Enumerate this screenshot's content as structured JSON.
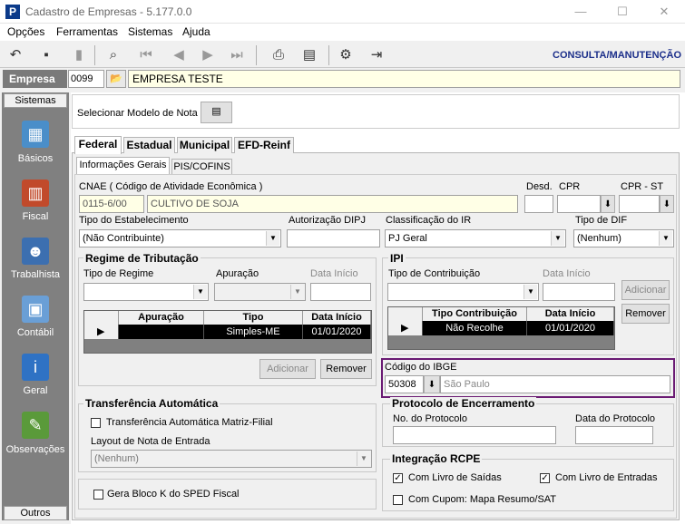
{
  "window": {
    "title": "Cadastro de Empresas - 5.177.0.0",
    "app_icon": "P",
    "min": "—",
    "max": "☐",
    "close": "✕"
  },
  "menu": [
    "Opções",
    "Ferramentas",
    "Sistemas",
    "Ajuda"
  ],
  "toolbar": {
    "mode": "CONSULTA/MANUTENÇÃO"
  },
  "empresa": {
    "label": "Empresa",
    "code": "0099",
    "name": "EMPRESA TESTE"
  },
  "sidebar": {
    "header": "Sistemas",
    "footer": "Outros",
    "items": [
      {
        "label": "Básicos",
        "icon": "basicos-icon",
        "color": "#4a8ec9"
      },
      {
        "label": "Fiscal",
        "icon": "fiscal-icon",
        "color": "#c14a2b"
      },
      {
        "label": "Trabalhista",
        "icon": "trabalhista-icon",
        "color": "#3c6fb0"
      },
      {
        "label": "Contábil",
        "icon": "contabil-icon",
        "color": "#6a9fd6"
      },
      {
        "label": "Geral",
        "icon": "geral-icon",
        "color": "#2f72c4"
      },
      {
        "label": "Observações",
        "icon": "observacoes-icon",
        "color": "#5a9a3a"
      }
    ]
  },
  "modelo": {
    "label": "Selecionar Modelo de Nota"
  },
  "tabs": [
    "Federal",
    "Estadual",
    "Municipal",
    "EFD-Reinf"
  ],
  "subtabs": [
    "Informações Gerais",
    "PIS/COFINS"
  ],
  "cnae": {
    "label": "CNAE ( Código de  Atividade Econômica )",
    "code": "0115-6/00",
    "desc": "CULTIVO DE SOJA"
  },
  "desd": {
    "label": "Desd.",
    "value": ""
  },
  "cpr": {
    "label": "CPR",
    "value": ""
  },
  "cpr_st": {
    "label": "CPR - ST",
    "value": ""
  },
  "tipo_estab": {
    "label": "Tipo do Estabelecimento",
    "value": "(Não Contribuinte)"
  },
  "aut_dipj": {
    "label": "Autorização DIPJ",
    "value": ""
  },
  "class_ir": {
    "label": "Classificação do IR",
    "value": "PJ Geral"
  },
  "tipo_dif": {
    "label": "Tipo de DIF",
    "value": "(Nenhum)"
  },
  "regime": {
    "title": "Regime de Tributação",
    "tipo_label": "Tipo de Regime",
    "apur_label": "Apuração",
    "data_label": "Data Início",
    "cols": [
      "Apuração",
      "Tipo",
      "Data Início"
    ],
    "row": [
      "",
      "Simples-ME",
      "01/01/2020"
    ],
    "add": "Adicionar",
    "remove": "Remover"
  },
  "ipi": {
    "title": "IPI",
    "tipo_label": "Tipo de Contribuição",
    "data_label": "Data Início",
    "add": "Adicionar",
    "remove": "Remover",
    "cols": [
      "Tipo Contribuição",
      "Data Início"
    ],
    "row": [
      "Não Recolhe",
      "01/01/2020"
    ]
  },
  "ibge": {
    "label": "Código do IBGE",
    "code": "50308",
    "city": "São Paulo"
  },
  "transf": {
    "title": "Transferência Automática",
    "check_label": "Transferência Automática Matriz-Filial",
    "layout_label": "Layout de Nota de Entrada",
    "layout_value": "(Nenhum)"
  },
  "protocolo": {
    "title": "Protocolo de Encerramento",
    "no_label": "No. do Protocolo",
    "data_label": "Data do Protocolo"
  },
  "bloco_k": {
    "label": "Gera Bloco K do SPED Fiscal"
  },
  "rcpe": {
    "title": "Integração RCPE",
    "saidas": "Com Livro de Saídas",
    "entradas": "Com Livro de Entradas",
    "cupom": "Com Cupom: Mapa Resumo/SAT"
  }
}
